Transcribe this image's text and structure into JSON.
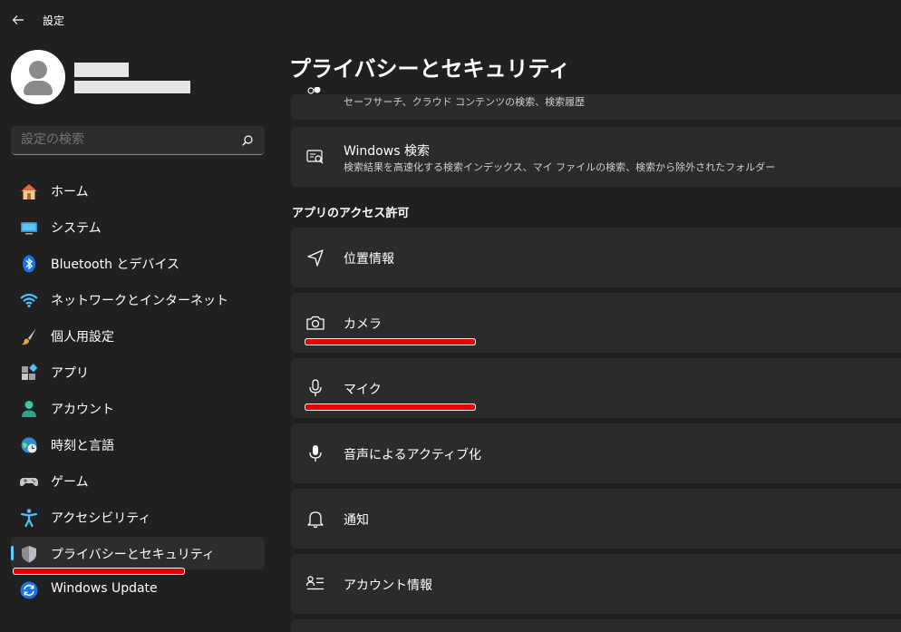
{
  "window": {
    "title": "設定"
  },
  "profile": {},
  "search": {
    "placeholder": "設定の検索"
  },
  "sidebar": {
    "items": [
      {
        "label": "ホーム",
        "icon": "home-icon"
      },
      {
        "label": "システム",
        "icon": "system-icon"
      },
      {
        "label": "Bluetooth とデバイス",
        "icon": "bluetooth-icon"
      },
      {
        "label": "ネットワークとインターネット",
        "icon": "wifi-icon"
      },
      {
        "label": "個人用設定",
        "icon": "brush-icon"
      },
      {
        "label": "アプリ",
        "icon": "apps-icon"
      },
      {
        "label": "アカウント",
        "icon": "account-icon"
      },
      {
        "label": "時刻と言語",
        "icon": "time-language-icon"
      },
      {
        "label": "ゲーム",
        "icon": "gamepad-icon"
      },
      {
        "label": "アクセシビリティ",
        "icon": "accessibility-icon"
      },
      {
        "label": "プライバシーとセキュリティ",
        "icon": "shield-icon",
        "selected": true
      },
      {
        "label": "Windows Update",
        "icon": "update-icon"
      }
    ]
  },
  "main": {
    "title": "プライバシーとセキュリティ",
    "search_permissions": {
      "subtitle": "セーフサーチ、クラウド コンテンツの検索、検索履歴"
    },
    "windows_search": {
      "title": "Windows 検索",
      "subtitle": "検索結果を高速化する検索インデックス、マイ ファイルの検索、検索から除外されたフォルダー"
    },
    "section_app_permissions": "アプリのアクセス許可",
    "app_permissions": [
      {
        "label": "位置情報",
        "icon": "location-icon"
      },
      {
        "label": "カメラ",
        "icon": "camera-icon"
      },
      {
        "label": "マイク",
        "icon": "microphone-icon"
      },
      {
        "label": "音声によるアクティブ化",
        "icon": "voice-activation-icon"
      },
      {
        "label": "通知",
        "icon": "bell-icon"
      },
      {
        "label": "アカウント情報",
        "icon": "account-info-icon"
      }
    ]
  },
  "colors": {
    "background": "#202020",
    "card": "#2b2b2b",
    "accent": "#60cdff",
    "annotation": "#e60000"
  }
}
